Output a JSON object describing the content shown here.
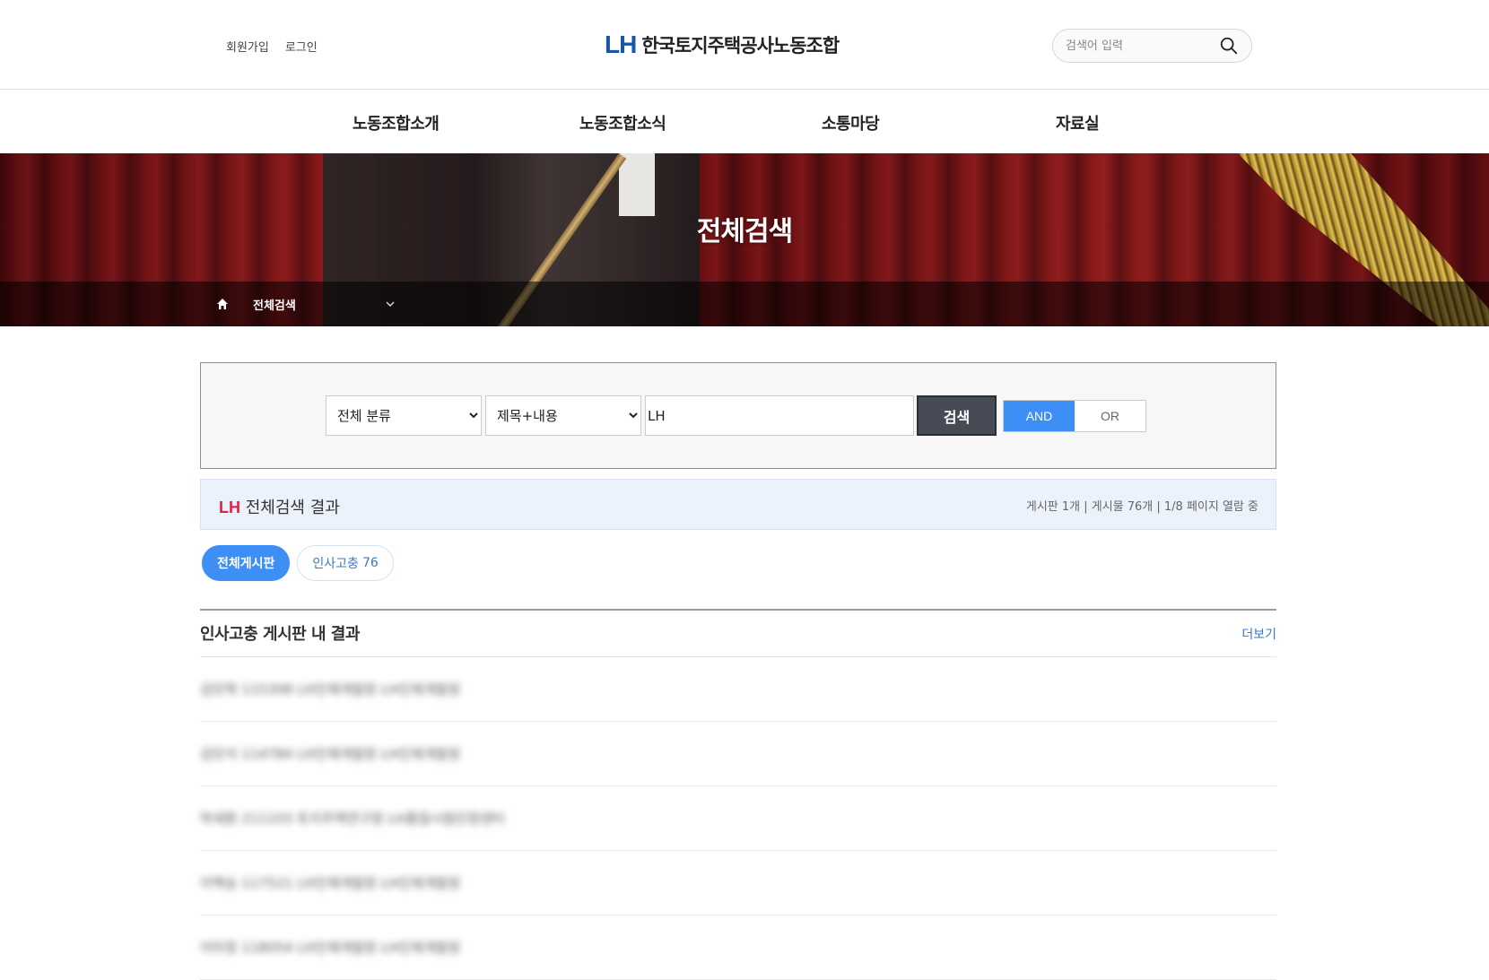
{
  "header": {
    "util": {
      "join": "회원가입",
      "login": "로그인"
    },
    "logo_mark": "LH",
    "logo_name": "한국토지주택공사노동조합",
    "search_placeholder": "검색어 입력"
  },
  "nav": [
    {
      "label": "노동조합소개"
    },
    {
      "label": "노동조합소식"
    },
    {
      "label": "소통마당"
    },
    {
      "label": "자료실"
    }
  ],
  "visual": {
    "title": "전체검색",
    "breadcrumb": "전체검색"
  },
  "search": {
    "category": "전체 분류",
    "field": "제목+내용",
    "keyword": "LH",
    "button": "검색",
    "and_label": "AND",
    "or_label": "OR"
  },
  "result": {
    "keyword": "LH",
    "label": "전체검색 결과",
    "meta": "게시판 1개 | 게시물 76개 | 1/8 페이지 열람 중"
  },
  "tabs": {
    "all": "전체게시판",
    "board_name": "인사고충",
    "board_count": "76"
  },
  "board": {
    "title": "인사고충 게시판 내 결과",
    "more": "더보기",
    "rows": [
      "김민혁 115308 LH인재개발원 LH인재개발원",
      "김민석 114784 LH인재개발원 LH인재개발원",
      "박세환 211103 토지주택연구원 LH품질시험인정센터",
      "이백승 117521 LH인재개발원 LH인재개발원",
      "이미정 118054 LH인재개발원 LH인재개발원"
    ]
  },
  "colors": {
    "brand": "#1a55a6",
    "accent": "#3d8ef5",
    "keyword": "#e0213f"
  }
}
